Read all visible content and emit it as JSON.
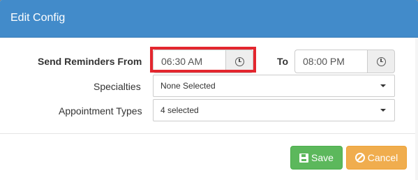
{
  "modal": {
    "title": "Edit Config"
  },
  "form": {
    "send_reminders_label": "Send Reminders From",
    "from_time": "06:30 AM",
    "to_label": "To",
    "to_time": "08:00 PM",
    "specialties_label": "Specialties",
    "specialties_value": "None Selected",
    "appointment_types_label": "Appointment Types",
    "appointment_types_value": "4 selected"
  },
  "footer": {
    "save_label": "Save",
    "cancel_label": "Cancel"
  },
  "icons": {
    "time_addon": "clock-icon",
    "dropdown": "caret-down-icon",
    "save": "floppy-disk-icon",
    "cancel": "ban-icon"
  },
  "colors": {
    "header": "#428bca",
    "save": "#5cb85c",
    "cancel": "#f0ad4e",
    "highlight": "#e3262e"
  }
}
